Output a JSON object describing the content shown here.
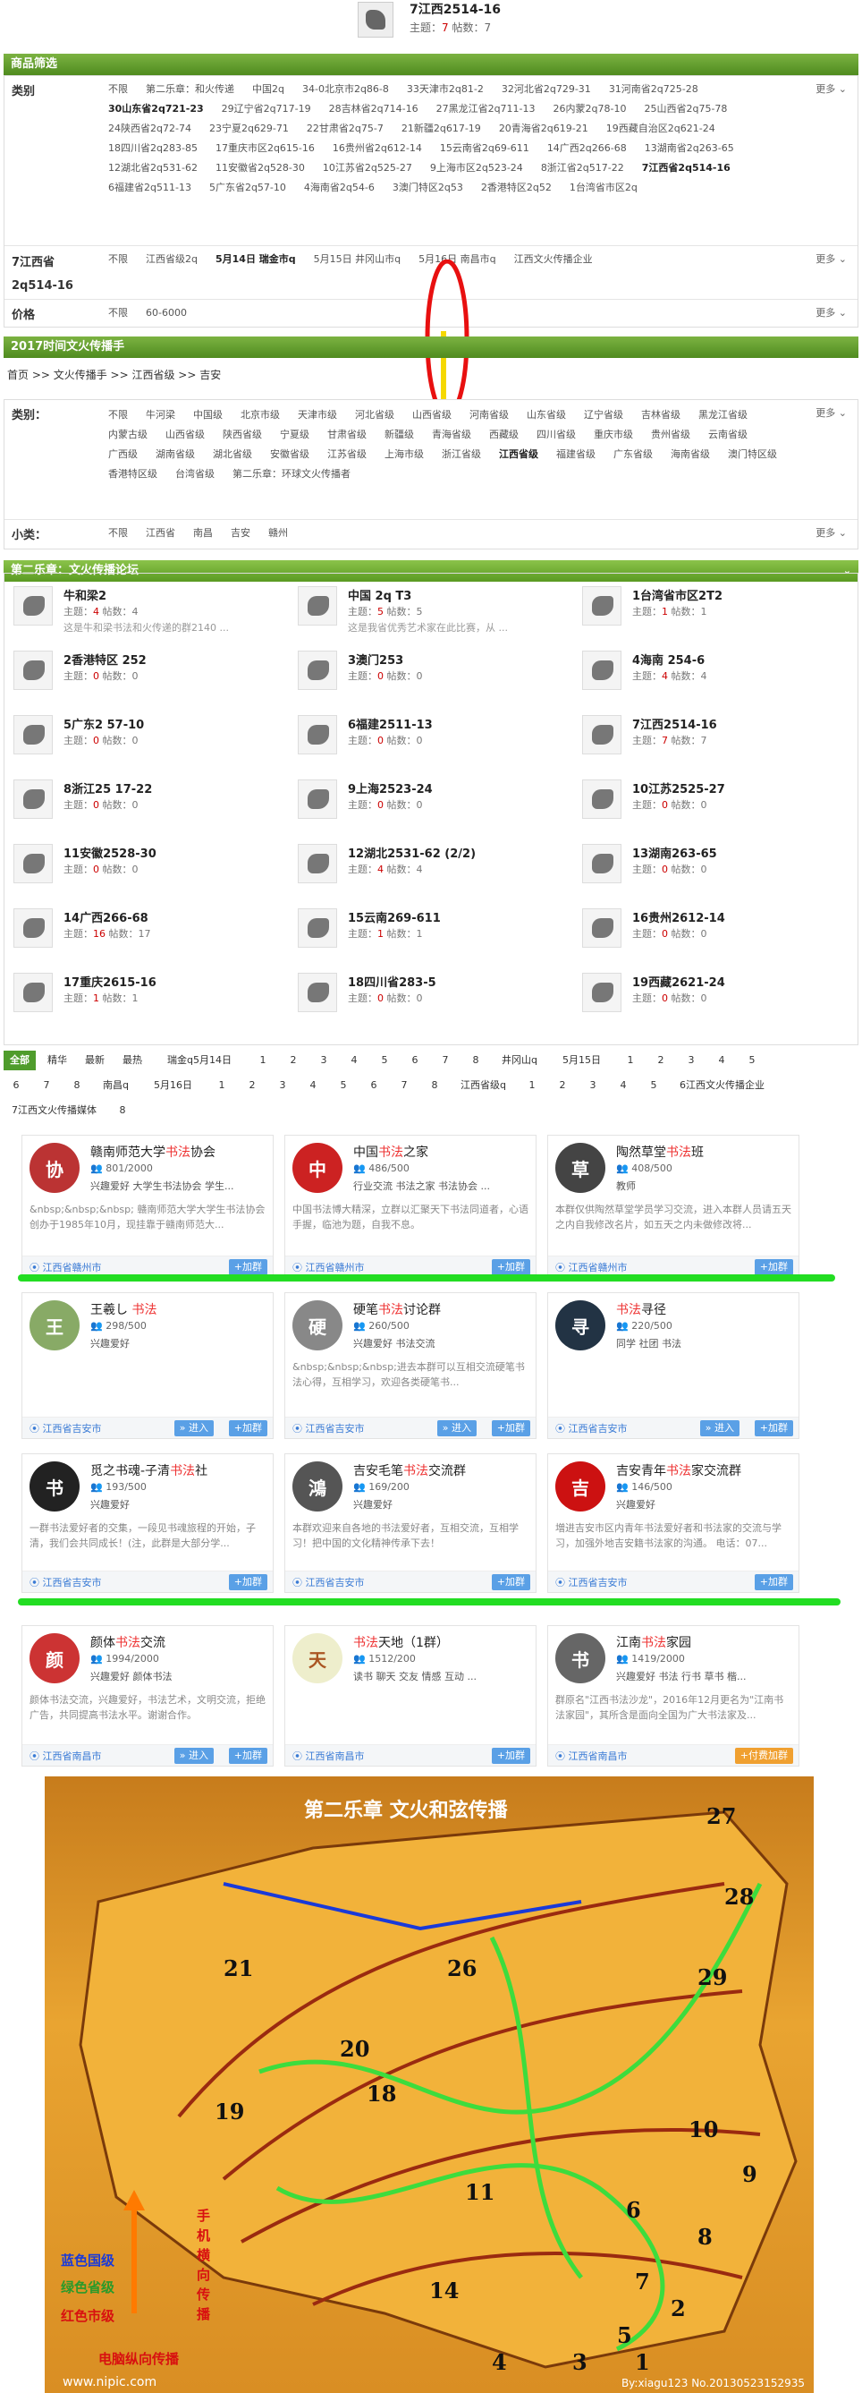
{
  "top_item": {
    "title": "7江西2514-16",
    "stats_prefix": "主题：",
    "topics": "7",
    "stats_mid": " 帖数：",
    "posts": "7"
  },
  "filter1": {
    "header": "商品筛选",
    "category_label": "类别",
    "category_values": [
      "不限",
      "第二乐章：和火传递",
      "中国2q",
      "34-0北京市2q86-8",
      "33天津市2q81-2",
      "32河北省2q729-31",
      "31河南省2q725-28",
      "30山东省2q721-23",
      "29辽宁省2q717-19",
      "28吉林省2q714-16",
      "27黑龙江省2q711-13",
      "26内蒙2q78-10",
      "25山西省2q75-78",
      "24陕西省2q72-74",
      "23宁夏2q629-71",
      "22甘肃省2q75-7",
      "21新疆2q617-19",
      "20青海省2q619-21",
      "19西藏自治区2q621-24",
      "18四川省2q283-85",
      "17重庆市区2q615-16",
      "16贵州省2q612-14",
      "15云南省2q69-611",
      "14广西2q266-68",
      "13湖南省2q263-65",
      "12湖北省2q531-62",
      "11安徽省2q528-30",
      "10江苏省2q525-27",
      "9上海市区2q523-24",
      "8浙江省2q517-22",
      "7江西省2q514-16",
      "6福建省2q511-13",
      "5广东省2q57-10",
      "4海南省2q54-6",
      "3澳门特区2q53",
      "2香港特区2q52",
      "1台湾省市区2q"
    ],
    "province_label": "7江西省2q514-16",
    "province_values": [
      "不限",
      "江西省级2q",
      "5月14日 瑞金市q",
      "5月15日 井冈山市q",
      "5月16日 南昌市q",
      "江西文火传播企业"
    ],
    "price_label": "价格",
    "price_values": [
      "不限",
      "60-6000"
    ],
    "more": "更多"
  },
  "filter2": {
    "header": "2017时间文火传播手",
    "breadcrumb": "首页  >>  文火传播手  >>  江西省级  >>  吉安",
    "category_label": "类别：",
    "category_values": [
      "不限",
      "牛河梁",
      "中国级",
      "北京市级",
      "天津市级",
      "河北省级",
      "山西省级",
      "河南省级",
      "山东省级",
      "辽宁省级",
      "吉林省级",
      "黑龙江省级",
      "内蒙古级",
      "山西省级",
      "陕西省级",
      "宁夏级",
      "甘肃省级",
      "新疆级",
      "青海省级",
      "西藏级",
      "四川省级",
      "重庆市级",
      "贵州省级",
      "云南省级",
      "广西级",
      "湖南省级",
      "湖北省级",
      "安徽省级",
      "江苏省级",
      "上海市级",
      "浙江省级",
      "江西省级",
      "福建省级",
      "广东省级",
      "海南省级",
      "澳门特区级",
      "香港特区级",
      "台湾省级",
      "第二乐章：环球文火传播者"
    ],
    "sub_label": "小类：",
    "sub_values": [
      "不限",
      "江西省",
      "南昌",
      "吉安",
      "赣州"
    ],
    "more": "更多"
  },
  "forum": {
    "header": "第二乐章：文火传播论坛",
    "stat_topic": "主题：",
    "stat_post": " 帖数：",
    "items": [
      {
        "name": "牛和梁2",
        "topics": "4",
        "posts": "4",
        "desc": "这是牛和梁书法和火传递的群2140 ..."
      },
      {
        "name": "中国 2q T3",
        "topics": "5",
        "posts": "5",
        "desc": "这是我省优秀艺术家在此比赛，从 ..."
      },
      {
        "name": "1台湾省市区2T2",
        "topics": "1",
        "posts": "1",
        "desc": ""
      },
      {
        "name": "2香港特区 252",
        "topics": "0",
        "posts": "0",
        "desc": ""
      },
      {
        "name": "3澳门253",
        "topics": "0",
        "posts": "0",
        "desc": ""
      },
      {
        "name": "4海南 254-6",
        "topics": "4",
        "posts": "4",
        "desc": ""
      },
      {
        "name": "5广东2 57-10",
        "topics": "0",
        "posts": "0",
        "desc": ""
      },
      {
        "name": "6福建2511-13",
        "topics": "0",
        "posts": "0",
        "desc": ""
      },
      {
        "name": "7江西2514-16",
        "topics": "7",
        "posts": "7",
        "desc": ""
      },
      {
        "name": "8浙江25 17-22",
        "topics": "0",
        "posts": "0",
        "desc": ""
      },
      {
        "name": "9上海2523-24",
        "topics": "0",
        "posts": "0",
        "desc": ""
      },
      {
        "name": "10江苏2525-27",
        "topics": "0",
        "posts": "0",
        "desc": ""
      },
      {
        "name": "11安徽2528-30",
        "topics": "0",
        "posts": "0",
        "desc": ""
      },
      {
        "name": "12湖北2531-62 (2/2)",
        "topics": "4",
        "posts": "4",
        "desc": ""
      },
      {
        "name": "13湖南263-65",
        "topics": "0",
        "posts": "0",
        "desc": ""
      },
      {
        "name": "14广西266-68",
        "topics": "16",
        "posts": "17",
        "desc": ""
      },
      {
        "name": "15云南269-611",
        "topics": "1",
        "posts": "1",
        "desc": ""
      },
      {
        "name": "16贵州2612-14",
        "topics": "0",
        "posts": "0",
        "desc": ""
      },
      {
        "name": "17重庆2615-16",
        "topics": "1",
        "posts": "1",
        "desc": ""
      },
      {
        "name": "18四川省283-5",
        "topics": "0",
        "posts": "0",
        "desc": ""
      },
      {
        "name": "19西藏2621-24",
        "topics": "0",
        "posts": "0",
        "desc": ""
      }
    ]
  },
  "tabs": {
    "row1": [
      "全部",
      "精华",
      "最新",
      "最热",
      "瑞金q5月14日",
      "1",
      "2",
      "3",
      "4",
      "5",
      "6",
      "7",
      "8",
      "井冈山q",
      "5月15日",
      "1",
      "2",
      "3",
      "4",
      "5"
    ],
    "row2": [
      "6",
      "7",
      "8",
      "南昌q",
      "5月16日",
      "1",
      "2",
      "3",
      "4",
      "5",
      "6",
      "7",
      "8",
      "江西省级q",
      "1",
      "2",
      "3",
      "4",
      "5",
      "6江西文火传播企业"
    ],
    "row3": [
      "7江西文火传播媒体",
      "8"
    ]
  },
  "groups": [
    {
      "name_pre": "赣南师范大学",
      "name_hl": "书法",
      "name_post": "协会",
      "members": "801/2000",
      "tags": "兴趣爱好  大学生书法协会  学生...",
      "desc": "&nbsp;&nbsp;&nbsp; 赣南师范大学大学生书法协会创办于1985年10月，现挂靠于赣南师范大...",
      "loc": "江西省赣州市",
      "btn": "+加群",
      "logo": "协"
    },
    {
      "name_pre": "中国",
      "name_hl": "书法",
      "name_post": "之家",
      "members": "486/500",
      "tags": "行业交流  书法之家  书法协会 ...",
      "desc": "中国书法博大精深，立群以汇聚天下书法同道者，心语手握，临池为题，自我不息。",
      "loc": "江西省赣州市",
      "btn": "+加群",
      "logo": "中"
    },
    {
      "name_pre": "陶然草堂",
      "name_hl": "书法",
      "name_post": "班",
      "members": "408/500",
      "tags": "教师",
      "desc": "本群仅供陶然草堂学员学习交流，进入本群人员请五天之内自我修改名片，如五天之内未做修改将...",
      "loc": "江西省赣州市",
      "btn": "+加群",
      "logo": "草"
    },
    {
      "name_pre": "王羲し ",
      "name_hl": "书法",
      "name_post": "",
      "members": "298/500",
      "tags": "兴趣爱好",
      "desc": "",
      "loc": "江西省吉安市",
      "btn": "+加群",
      "btn2": "» 进入",
      "logo": "王"
    },
    {
      "name_pre": "硬笔",
      "name_hl": "书法",
      "name_post": "讨论群",
      "members": "260/500",
      "tags": "兴趣爱好  书法交流",
      "desc": "&nbsp;&nbsp;&nbsp;进去本群可以互相交流硬笔书法心得，互相学习，欢迎各类硬笔书...",
      "loc": "江西省吉安市",
      "btn": "+加群",
      "btn2": "» 进入",
      "logo": "硬"
    },
    {
      "name_pre": "",
      "name_hl": "书法",
      "name_post": "寻径",
      "members": "220/500",
      "tags": "同学  社团  书法",
      "desc": "",
      "loc": "江西省吉安市",
      "btn": "+加群",
      "btn2": "» 进入",
      "logo": "寻"
    },
    {
      "name_pre": "觅之书魂-子清",
      "name_hl": "书法",
      "name_post": "社",
      "members": "193/500",
      "tags": "兴趣爱好",
      "desc": "一群书法爱好者的交集，一段见书魂旅程的开始，子清，我们会共同成长！(注，此群是大部分学...",
      "loc": "江西省吉安市",
      "btn": "+加群",
      "logo": "书"
    },
    {
      "name_pre": "吉安毛笔",
      "name_hl": "书法",
      "name_post": "交流群",
      "members": "169/200",
      "tags": "兴趣爱好",
      "desc": "本群欢迎来自各地的书法爱好者，互相交流，互相学习！把中国的文化精神传承下去！",
      "loc": "江西省吉安市",
      "btn": "+加群",
      "logo": "鴻"
    },
    {
      "name_pre": "吉安青年",
      "name_hl": "书法",
      "name_post": "家交流群",
      "members": "146/500",
      "tags": "兴趣爱好",
      "desc": "増进吉安市区内青年书法爱好者和书法家的交流与学习，加强外地吉安籍书法家的沟通。 电话：07...",
      "loc": "江西省吉安市",
      "btn": "+加群",
      "logo": "吉"
    },
    {
      "name_pre": "颜体",
      "name_hl": "书法",
      "name_post": "交流",
      "members": "1994/2000",
      "tags": "兴趣爱好  颜体书法",
      "desc": "颜体书法交流，兴趣爱好，书法艺术，文明交流，拒绝广告，共同提高书法水平。谢谢合作。",
      "loc": "江西省南昌市",
      "btn": "+加群",
      "btn2": "» 进入",
      "logo": "颜"
    },
    {
      "name_pre": "",
      "name_hl": "书法",
      "name_post": "天地（1群）",
      "members": "1512/200",
      "tags": "读书  聊天  交友  情感  互动 ...",
      "desc": "",
      "loc": "江西省南昌市",
      "btn": "+加群",
      "logo": "天"
    },
    {
      "name_pre": "江南",
      "name_hl": "书法",
      "name_post": "家园",
      "members": "1419/2000",
      "tags": "兴趣爱好  书法  行书  草书  楷...",
      "desc": "群原名\"江西书法沙龙\"，2016年12月更名为\"江南书法家园\"，其所含是面向全国为广大书法家及...",
      "loc": "江西省南昌市",
      "btn": "+付费加群",
      "btn_type": "org",
      "logo": "书"
    }
  ],
  "map": {
    "title": "第二乐章 文火和弦传播",
    "legend_blue": "蓝色国级",
    "legend_green": "绿色省级",
    "legend_red": "红色市级",
    "side_text": "手机横向传播",
    "bottom_text": "电脑纵向传播",
    "watermark": "www.nipic.com",
    "credit": "By:xiagu123  No.20130523152935",
    "numbers": [
      "27",
      "28",
      "29",
      "21",
      "20",
      "19",
      "26",
      "18",
      "10",
      "9",
      "8",
      "7",
      "6",
      "5",
      "4",
      "3",
      "2",
      "1",
      "14",
      "11"
    ]
  },
  "colors": {
    "green": "#4f9c2c",
    "bright_green": "#22dd22",
    "red": "#e33333",
    "blue": "#3a7bd5"
  }
}
